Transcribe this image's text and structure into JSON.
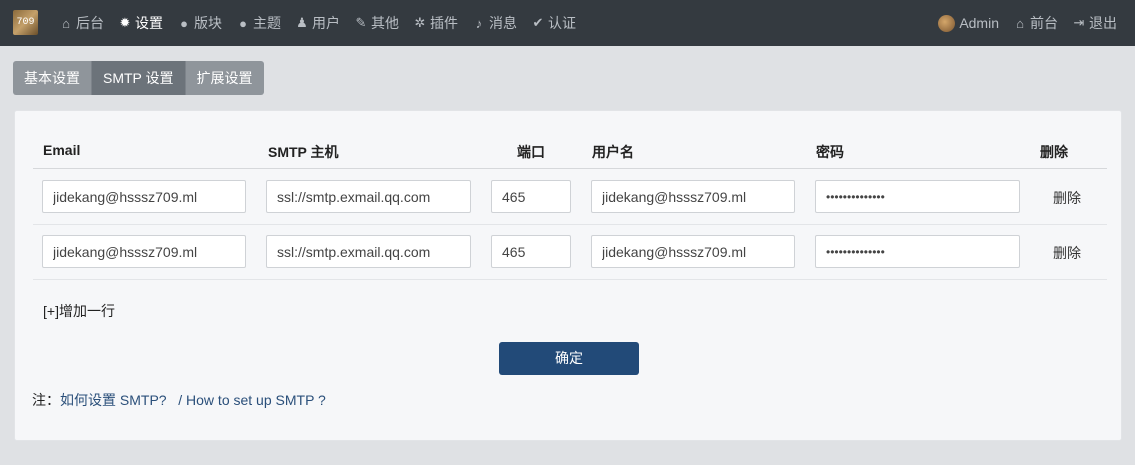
{
  "nav": {
    "logo_text": "709",
    "left": [
      {
        "icon": "home-icon",
        "glyph": "⌂",
        "label": "后台",
        "active": false
      },
      {
        "icon": "gear-icon",
        "glyph": "✹",
        "label": "设置",
        "active": true
      },
      {
        "icon": "comment-icon",
        "glyph": "●",
        "label": "版块",
        "active": false
      },
      {
        "icon": "comment-icon",
        "glyph": "●",
        "label": "主题",
        "active": false
      },
      {
        "icon": "user-icon",
        "glyph": "♟",
        "label": "用户",
        "active": false
      },
      {
        "icon": "wrench-icon",
        "glyph": "✎",
        "label": "其他",
        "active": false
      },
      {
        "icon": "gears-icon",
        "glyph": "✲",
        "label": "插件",
        "active": false
      },
      {
        "icon": "bell-icon",
        "glyph": "♪",
        "label": "消息",
        "active": false
      },
      {
        "icon": "check-icon",
        "glyph": "✔",
        "label": "认证",
        "active": false
      }
    ],
    "right": {
      "admin_label": "Admin",
      "front_label": "前台",
      "front_glyph": "⌂",
      "logout_label": "退出",
      "logout_glyph": "⇥"
    }
  },
  "tabs": [
    {
      "label": "基本设置",
      "active": false
    },
    {
      "label": "SMTP 设置",
      "active": true
    },
    {
      "label": "扩展设置",
      "active": false
    }
  ],
  "table": {
    "headers": {
      "email": "Email",
      "host": "SMTP 主机",
      "port": "端口",
      "user": "用户名",
      "password": "密码",
      "delete": "删除"
    },
    "rows": [
      {
        "email": "jidekang@hsssz709.ml",
        "host": "ssl://smtp.exmail.qq.com",
        "port": "465",
        "user": "jidekang@hsssz709.ml",
        "password": "••••••••••••••",
        "delete_label": "删除"
      },
      {
        "email": "jidekang@hsssz709.ml",
        "host": "ssl://smtp.exmail.qq.com",
        "port": "465",
        "user": "jidekang@hsssz709.ml",
        "password": "••••••••••••••",
        "delete_label": "删除"
      }
    ]
  },
  "add_row_label": "[+]增加一行",
  "submit_label": "确定",
  "note": {
    "prefix": "注：",
    "link_cn": "如何设置 SMTP?",
    "link_en": " / How to set up SMTP ?"
  },
  "colors": {
    "navbar": "#343a40",
    "submit": "#224a78",
    "tab_active": "#6c737a",
    "tab": "#8f959b"
  }
}
